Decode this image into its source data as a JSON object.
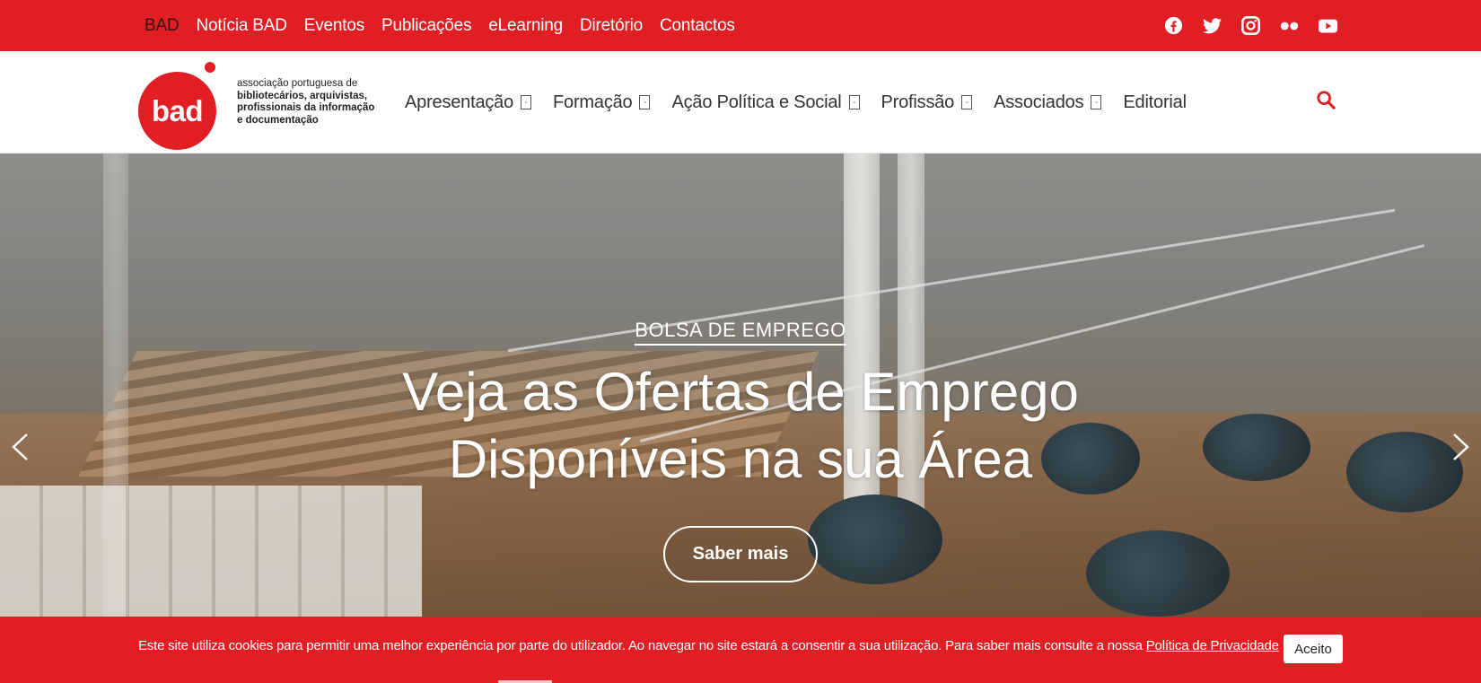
{
  "topbar": {
    "links": [
      {
        "label": "BAD",
        "active": true
      },
      {
        "label": "Notícia BAD"
      },
      {
        "label": "Eventos"
      },
      {
        "label": "Publicações"
      },
      {
        "label": "eLearning"
      },
      {
        "label": "Diretório"
      },
      {
        "label": "Contactos"
      }
    ],
    "social_icons": [
      "facebook-icon",
      "twitter-icon",
      "instagram-icon",
      "flickr-icon",
      "youtube-icon"
    ]
  },
  "header": {
    "logo_text": "bad",
    "tagline_line1": "associação portuguesa de",
    "tagline_line2": "bibliotecários, arquivistas,",
    "tagline_line3": "profissionais da informação",
    "tagline_line4": "e documentação",
    "nav": [
      {
        "label": "Apresentação",
        "has_dropdown": true
      },
      {
        "label": "Formação",
        "has_dropdown": true
      },
      {
        "label": "Ação Política e Social",
        "has_dropdown": true
      },
      {
        "label": "Profissão",
        "has_dropdown": true
      },
      {
        "label": "Associados",
        "has_dropdown": true
      },
      {
        "label": "Editorial",
        "has_dropdown": false
      }
    ],
    "caret_glyph": "F1\n90",
    "search_icon": "search-icon"
  },
  "hero": {
    "kicker": "BOLSA DE EMPREGO",
    "headline_line1": "Veja as Ofertas de Emprego",
    "headline_line2": "Disponíveis na sua Área",
    "cta_label": "Saber mais"
  },
  "cookie": {
    "text": "Este site utiliza cookies para permitir uma melhor experiência por parte do utilizador. Ao navegar no site estará a consentir a sua utilização. Para saber mais consulte a nossa",
    "link_label": "Política de Privacidade",
    "accept_label": "Aceito"
  },
  "colors": {
    "brand_red": "#e01e24",
    "text_dark": "#333333",
    "white": "#ffffff"
  }
}
